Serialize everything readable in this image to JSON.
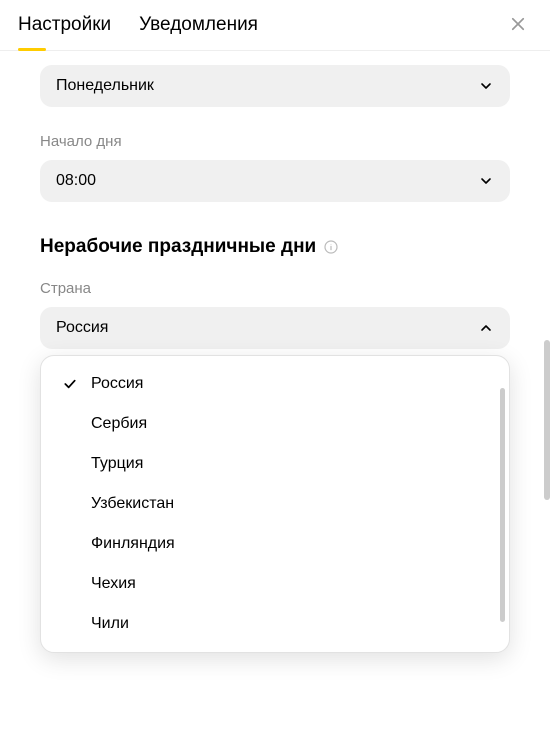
{
  "header": {
    "tabs": [
      {
        "label": "Настройки",
        "active": true
      },
      {
        "label": "Уведомления",
        "active": false
      }
    ]
  },
  "week_start": {
    "value": "Понедельник"
  },
  "day_start": {
    "label": "Начало дня",
    "value": "08:00"
  },
  "holidays": {
    "title": "Нерабочие праздничные дни",
    "country_label": "Страна",
    "selected": "Россия",
    "options": [
      {
        "label": "Россия",
        "selected": true
      },
      {
        "label": "Сербия",
        "selected": false
      },
      {
        "label": "Турция",
        "selected": false
      },
      {
        "label": "Узбекистан",
        "selected": false
      },
      {
        "label": "Финляндия",
        "selected": false
      },
      {
        "label": "Чехия",
        "selected": false
      },
      {
        "label": "Чили",
        "selected": false
      }
    ]
  }
}
